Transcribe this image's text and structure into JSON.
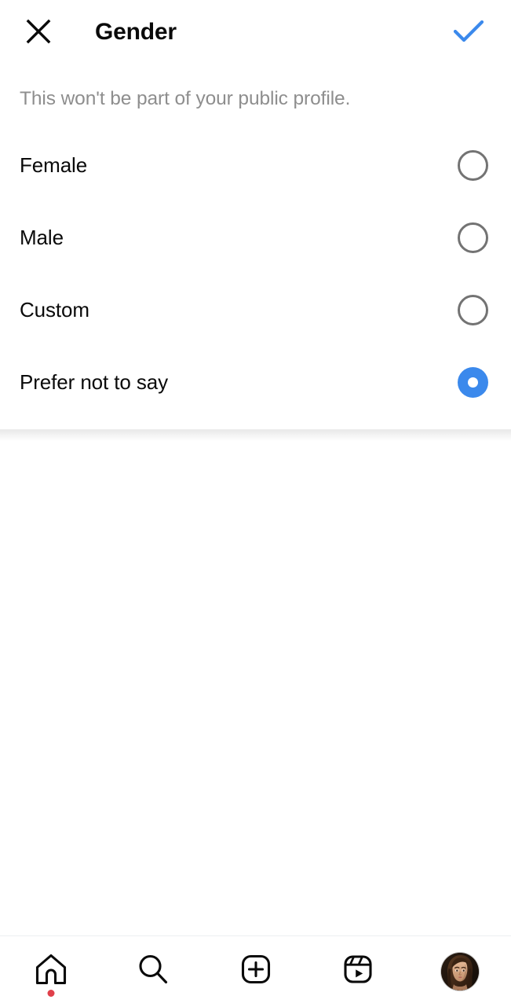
{
  "header": {
    "title": "Gender",
    "close_icon": "close-x-icon",
    "confirm_icon": "checkmark-icon",
    "confirm_color": "#3b89ec"
  },
  "subtitle": "This won't be part of your public profile.",
  "options": [
    {
      "label": "Female",
      "selected": false
    },
    {
      "label": "Male",
      "selected": false
    },
    {
      "label": "Custom",
      "selected": false
    },
    {
      "label": "Prefer not to say",
      "selected": true
    }
  ],
  "colors": {
    "radio_selected": "#3b89ec",
    "radio_unselected": "#737373",
    "accent": "#3b89ec",
    "subtitle_text": "#8e8e8e",
    "primary_text": "#0a0a0a",
    "notification_dot": "#e0404a",
    "divider": "#ececec"
  },
  "bottom_nav": [
    {
      "name": "home",
      "icon": "home-icon",
      "has_notification_dot": true
    },
    {
      "name": "search",
      "icon": "search-icon",
      "has_notification_dot": false
    },
    {
      "name": "create",
      "icon": "plus-square-icon",
      "has_notification_dot": false
    },
    {
      "name": "reels",
      "icon": "reels-icon",
      "has_notification_dot": false
    },
    {
      "name": "profile",
      "icon": "profile-avatar",
      "has_notification_dot": false
    }
  ]
}
